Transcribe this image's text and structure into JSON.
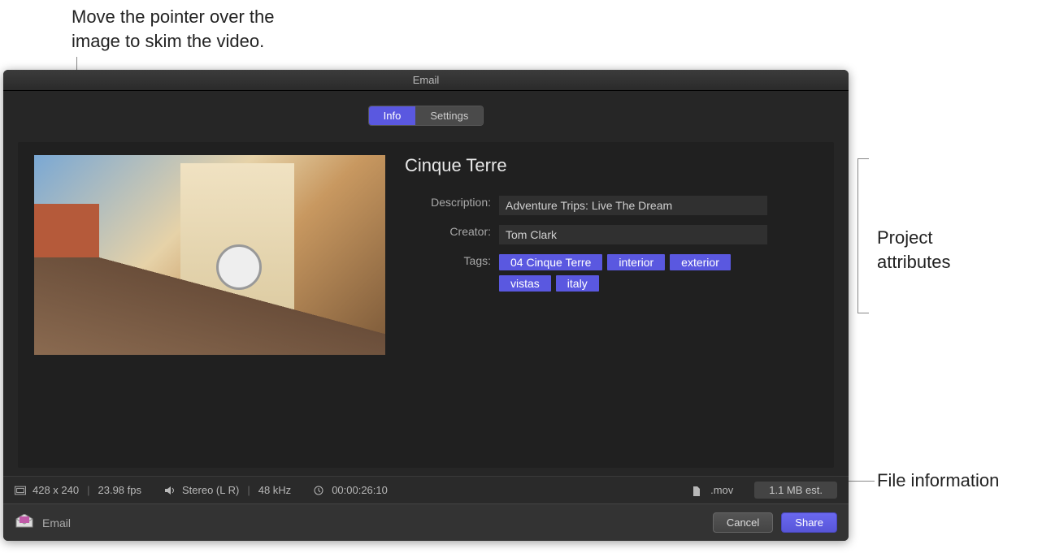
{
  "callouts": {
    "top": "Move the pointer over the\nimage to skim the video.",
    "right1": "Project\nattributes",
    "right2": "File information"
  },
  "window": {
    "title": "Email"
  },
  "tabs": {
    "info": "Info",
    "settings": "Settings"
  },
  "project": {
    "title": "Cinque Terre",
    "description_label": "Description:",
    "description_value": "Adventure Trips: Live The Dream",
    "creator_label": "Creator:",
    "creator_value": "Tom Clark",
    "tags_label": "Tags:",
    "tags": [
      "04 Cinque Terre",
      "interior",
      "exterior",
      "vistas",
      "italy"
    ]
  },
  "fileinfo": {
    "dimensions": "428 x 240",
    "fps": "23.98 fps",
    "audio": "Stereo (L R)",
    "samplerate": "48 kHz",
    "duration": "00:00:26:10",
    "extension": ".mov",
    "size_est": "1.1 MB est."
  },
  "footer": {
    "dest_label": "Email",
    "cancel": "Cancel",
    "share": "Share"
  }
}
